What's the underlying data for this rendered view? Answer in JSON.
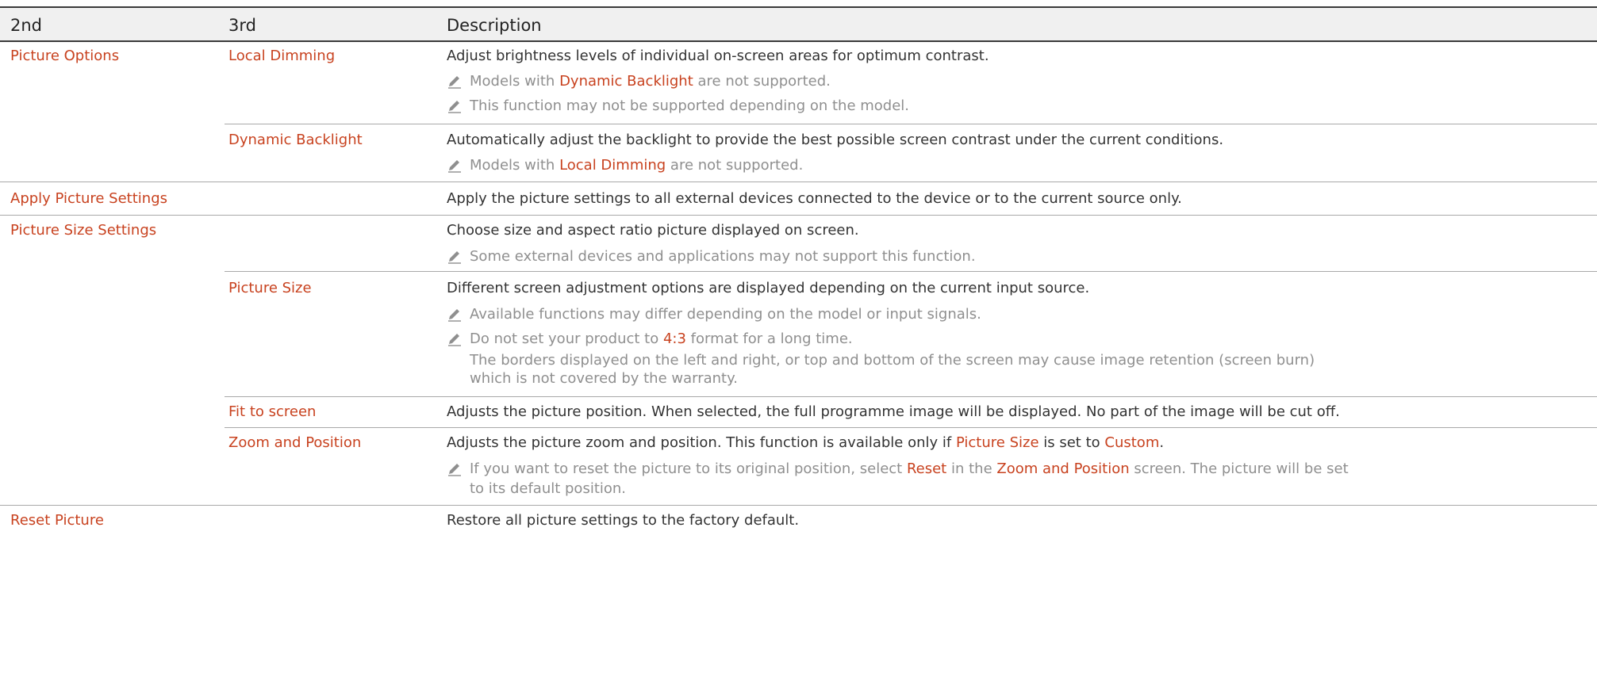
{
  "headers": [
    "2nd",
    "3rd",
    "Description"
  ],
  "rows": {
    "picture_options": "Picture Options",
    "local_dimming": "Local Dimming",
    "local_dimming_desc": "Adjust brightness levels of individual on-screen areas for optimum contrast.",
    "ld_note1": [
      "Models with ",
      "Dynamic Backlight",
      " are not supported."
    ],
    "ld_note2": "This function may not be supported depending on the model.",
    "dynamic_backlight": "Dynamic Backlight",
    "dynamic_backlight_desc": "Automatically adjust the backlight to provide the best possible screen contrast under the current conditions.",
    "db_note1": [
      "Models with ",
      "Local Dimming",
      " are not supported."
    ],
    "apply_picture_settings": "Apply Picture Settings",
    "apply_desc": "Apply the picture settings to all external devices connected to the device or to the current source only.",
    "picture_size_settings": "Picture Size Settings",
    "pss_desc": "Choose size and aspect ratio picture displayed on screen.",
    "pss_note1": "Some external devices and applications may not support this function.",
    "picture_size": "Picture Size",
    "ps_desc": "Different screen adjustment options are displayed depending on the current input source.",
    "ps_note1": "Available functions may differ depending on the model or input signals.",
    "ps_note2": [
      "Do not set your product to ",
      "4:3",
      " format for a long time."
    ],
    "ps_note2_line2": "The borders displayed on the left and right, or top and bottom of the screen may cause image retention (screen burn)",
    "ps_note2_line3": "which is not covered by the warranty.",
    "fit_to_screen": "Fit to screen",
    "fit_desc": "Adjusts the picture position. When selected, the full programme image will be displayed. No part of the image will be cut off.",
    "zoom_and_position": "Zoom and Position",
    "zoom_desc": [
      "Adjusts the picture zoom and position. This function is available only if ",
      "Picture Size",
      " is set to ",
      "Custom",
      "."
    ],
    "zoom_note1": [
      "If you want to reset the picture to its original position, select ",
      "Reset",
      " in the ",
      "Zoom and Position",
      " screen. The picture will be set"
    ],
    "zoom_note1_line2": "to its default position.",
    "reset_picture": "Reset Picture",
    "reset_desc": "Restore all picture settings to the factory default."
  },
  "colors": {
    "accent": "#c8421f",
    "note": "#8f8f8f",
    "text": "#333333",
    "header_bg": "#f0f0f0"
  },
  "icons": {
    "note": "pencil-icon"
  }
}
